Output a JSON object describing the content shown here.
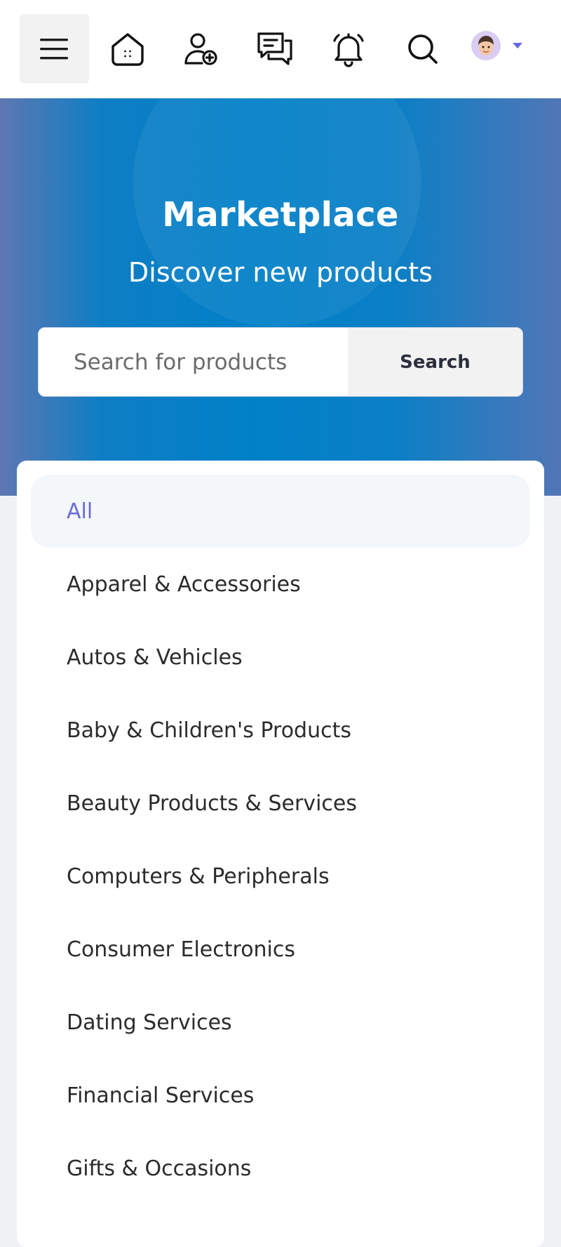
{
  "topbar": {
    "icons": [
      "menu-icon",
      "home-icon",
      "add-friend-icon",
      "messages-icon",
      "bell-icon",
      "search-icon",
      "avatar",
      "chevron-down-icon"
    ],
    "accent_color": "#6767e0"
  },
  "hero": {
    "title": "Marketplace",
    "subtitle": "Discover new products",
    "search_placeholder": "Search for products",
    "search_button": "Search",
    "gradient_colors": [
      "#5f77b2",
      "#0180c8",
      "#5176b6"
    ]
  },
  "categories": {
    "active_color": "#6a6ad6",
    "items": [
      {
        "label": "All",
        "active": true
      },
      {
        "label": "Apparel & Accessories"
      },
      {
        "label": "Autos & Vehicles"
      },
      {
        "label": "Baby & Children's Products"
      },
      {
        "label": "Beauty Products & Services"
      },
      {
        "label": "Computers & Peripherals"
      },
      {
        "label": "Consumer Electronics"
      },
      {
        "label": "Dating Services"
      },
      {
        "label": "Financial Services"
      },
      {
        "label": "Gifts & Occasions"
      }
    ]
  }
}
